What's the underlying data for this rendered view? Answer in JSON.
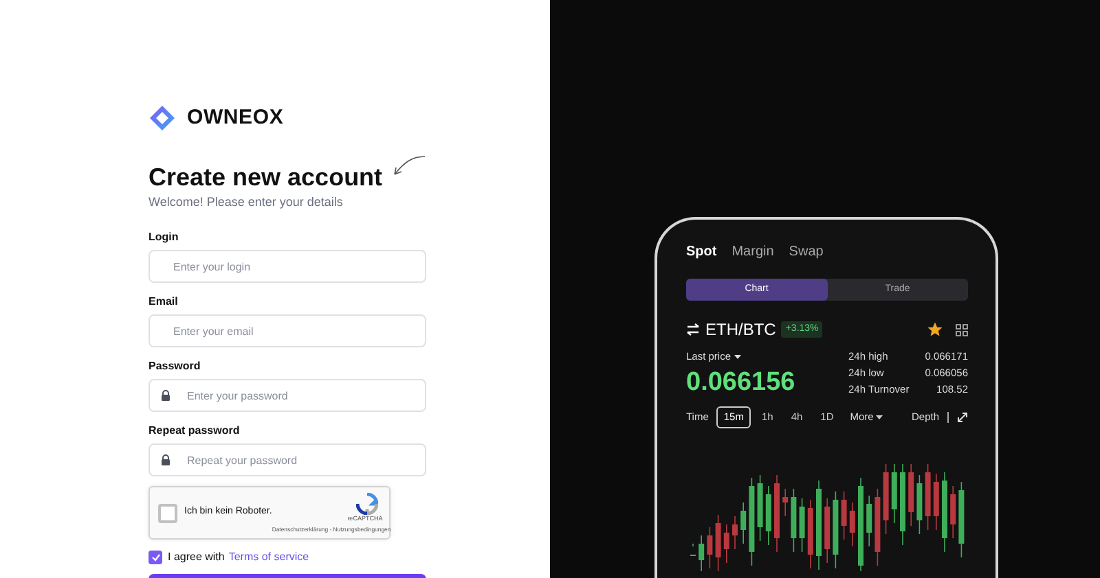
{
  "brand": {
    "name": "OWNEOX"
  },
  "heading": "Create new account",
  "subtitle": "Welcome! Please enter your details",
  "fields": [
    {
      "label": "Login",
      "placeholder": "Enter your login",
      "kind": "text"
    },
    {
      "label": "Email",
      "placeholder": "Enter your email",
      "kind": "text"
    },
    {
      "label": "Password",
      "placeholder": "Enter your password",
      "kind": "password"
    },
    {
      "label": "Repeat password",
      "placeholder": "Repeat your password",
      "kind": "password"
    }
  ],
  "captcha": {
    "label": "Ich bin kein Roboter.",
    "checked": false,
    "brand": "reCAPTCHA",
    "links": "Datenschutzerklärung - Nutzungsbedingungen"
  },
  "terms": {
    "checked": true,
    "text": "I agree with",
    "link": "Terms of service"
  },
  "phone": {
    "tabs": [
      {
        "label": "Spot",
        "selected": true
      },
      {
        "label": "Margin",
        "selected": false
      },
      {
        "label": "Swap",
        "selected": false
      }
    ],
    "segments": [
      {
        "label": "Chart",
        "selected": true
      },
      {
        "label": "Trade",
        "selected": false
      }
    ],
    "pair": "ETH/BTC",
    "change": "+3.13%",
    "favorite": true,
    "last_price_label": "Last price",
    "price": "0.066156",
    "stats": [
      {
        "label": "24h high",
        "value": "0.066171"
      },
      {
        "label": "24h low",
        "value": "0.066056"
      },
      {
        "label": "24h Turnover",
        "value": "108.52"
      }
    ],
    "time_label": "Time",
    "timeframes": [
      {
        "label": "15m",
        "selected": true
      },
      {
        "label": "1h",
        "selected": false
      },
      {
        "label": "4h",
        "selected": false
      },
      {
        "label": "1D",
        "selected": false
      }
    ],
    "more": "More",
    "depth": "Depth"
  }
}
